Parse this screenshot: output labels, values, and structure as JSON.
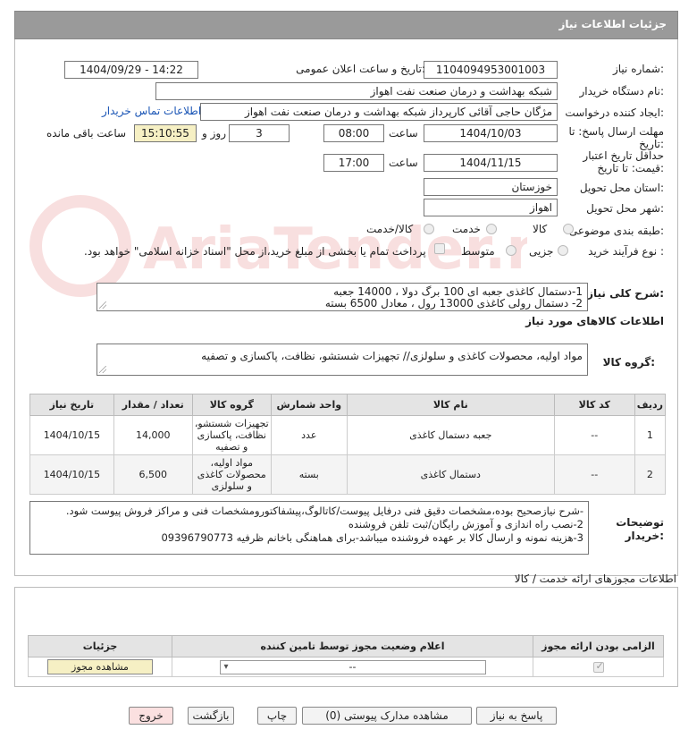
{
  "header": {
    "title": "جزئیات اطلاعات نیاز"
  },
  "fields": {
    "need_number_label": "شماره نیاز:",
    "need_number": "1104094953001003",
    "announce_label": "تاریخ و ساعت اعلان عمومی:",
    "announce_value": "1404/09/29 - 14:22",
    "buyer_org_label": "نام دستگاه خریدار:",
    "buyer_org": "شبکه بهداشت و درمان صنعت نفت اهواز",
    "creator_label": "ایجاد کننده درخواست:",
    "creator": "مژگان حاجی آقائی کارپرداز شبکه بهداشت و درمان صنعت نفت اهواز",
    "buyer_contact_link": "اطلاعات تماس خریدار",
    "deadline_label_1": "مهلت ارسال پاسخ: تا",
    "deadline_label_2": "تاریخ:",
    "deadline_date": "1404/10/03",
    "time_label": "ساعت",
    "deadline_time": "08:00",
    "days_value": "3",
    "days_label": "روز و",
    "remaining_time": "15:10:55",
    "remaining_label": "ساعت باقی مانده",
    "validity_label_1": "حداقل تاریخ اعتبار",
    "validity_label_2": "قیمت: تا تاریخ:",
    "validity_date": "1404/11/15",
    "validity_time_label": "ساعت",
    "validity_time": "17:00",
    "province_label": "استان محل تحویل:",
    "province": "خوزستان",
    "city_label": "شهر محل تحویل:",
    "city": "اهواز",
    "category_label": "طبقه بندی موضوعی:",
    "category_options": [
      "کالا",
      "خدمت",
      "کالا/خدمت"
    ],
    "process_label": "نوع فرآیند خرید :",
    "process_options": [
      "جزیی",
      "متوسط"
    ],
    "treasury_note": "پرداخت تمام یا بخشی از مبلغ خرید،از محل \"اسناد خزانه اسلامی\" خواهد بود."
  },
  "summary": {
    "label": "شرح کلی نیاز:",
    "line1": "1-دستمال کاغذی جعبه ای 100 برگ  دولا    ،    14000 جعبه",
    "line2": "2- دستمال رولی کاغذی 13000  رول   ،       معادل 6500  بسته"
  },
  "goods_section": {
    "title": "اطلاعات کالاهای مورد نیاز",
    "group_label": "گروه کالا:",
    "group_value": "مواد اولیه، محصولات کاغذی و سلولزی// تجهیزات شستشو، نظافت، پاکسازی و تصفیه"
  },
  "goods_table": {
    "headers": [
      "ردیف",
      "کد کالا",
      "نام کالا",
      "واحد شمارش",
      "گروه کالا",
      "تعداد / مقدار",
      "تاریخ نیاز"
    ],
    "rows": [
      {
        "row": "1",
        "code": "--",
        "name": "جعبه دستمال کاغذی",
        "unit": "عدد",
        "group": "تجهیزات شستشو، نظافت، پاکسازی و تصفیه",
        "qty": "14,000",
        "date": "1404/10/15"
      },
      {
        "row": "2",
        "code": "--",
        "name": "دستمال کاغذی",
        "unit": "بسته",
        "group": "مواد اولیه، محصولات کاغذی و سلولزی",
        "qty": "6,500",
        "date": "1404/10/15"
      }
    ]
  },
  "buyer_notes": {
    "label_1": "توضیحات",
    "label_2": "خریدار:",
    "line1": "-شرح نیازصحیح بوده،مشخصات دقیق فنی درفایل پیوست/کاتالوگ،پیشفاکتورومشخصات فنی و مراکز فروش پیوست شود.",
    "line2": "2-نصب راه اندازی و آموزش رایگان/ثبت تلفن فروشنده",
    "line3": "3-هزینه  نمونه و ارسال کالا بر عهده فروشنده میباشد-برای هماهنگی باخانم ظرفیه 09396790773"
  },
  "permits": {
    "title": "اطلاعات مجوزهای ارائه خدمت / کالا",
    "headers": [
      "الزامی بودن ارائه مجوز",
      "اعلام وضعیت مجوز توسط تامین کننده",
      "جزئیات"
    ],
    "select_value": "--",
    "view_button": "مشاهده مجوز"
  },
  "footer_buttons": {
    "reply": "پاسخ به نیاز",
    "attachments": "مشاهده مدارک پیوستی (0)",
    "print": "چاپ",
    "back": "بازگشت",
    "exit": "خروج"
  },
  "colors": {
    "header_bg": "#9a9a9a",
    "link": "#1a55b5",
    "highlight": "#f6f0c4",
    "exit_bg": "#fbe0e0"
  }
}
